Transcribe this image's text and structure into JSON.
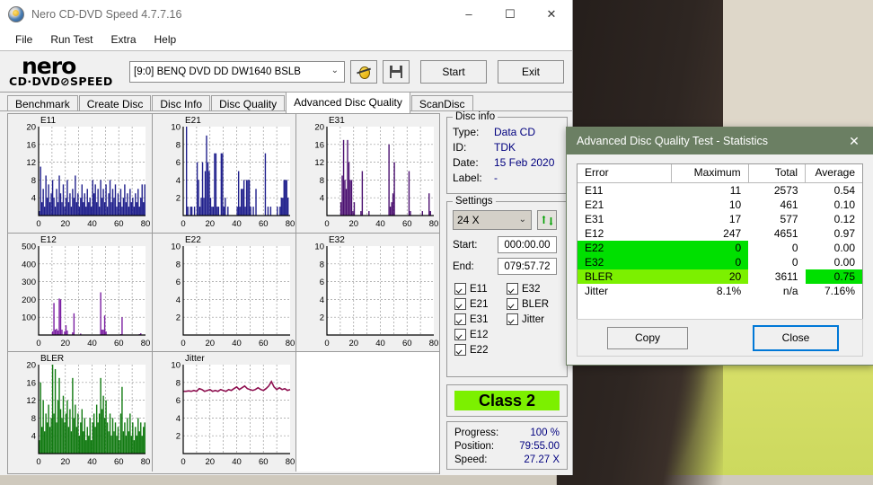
{
  "window": {
    "title": "Nero CD-DVD Speed 4.7.7.16",
    "app_icon": "nero-disc-icon",
    "minimize": "–",
    "maximize": "☐",
    "close": "✕"
  },
  "menu": {
    "items": [
      "File",
      "Run Test",
      "Extra",
      "Help"
    ]
  },
  "logo": {
    "line1": "nero",
    "line2": "CD·DVD⊘SPEED"
  },
  "toolbar": {
    "drive": "[9:0]   BENQ DVD DD DW1640 BSLB",
    "dropdown_caret": "⌄",
    "bug_icon": "bug-icon",
    "save_icon": "floppy-save-icon",
    "start_label": "Start",
    "exit_label": "Exit"
  },
  "tabs": {
    "items": [
      "Benchmark",
      "Create Disc",
      "Disc Info",
      "Disc Quality",
      "Advanced Disc Quality",
      "ScanDisc"
    ],
    "active": "Advanced Disc Quality"
  },
  "disc_info": {
    "legend": "Disc info",
    "rows": [
      {
        "key": "Type:",
        "value": "Data CD"
      },
      {
        "key": "ID:",
        "value": "TDK"
      },
      {
        "key": "Date:",
        "value": "15 Feb 2020"
      },
      {
        "key": "Label:",
        "value": "-"
      }
    ]
  },
  "settings": {
    "legend": "Settings",
    "speed": "24 X",
    "speed_caret": "⌄",
    "refresh_icon": "refresh-icon",
    "start_label": "Start:",
    "start_value": "000:00.00",
    "end_label": "End:",
    "end_value": "079:57.72",
    "checkboxes_left": [
      "E11",
      "E21",
      "E31",
      "E12",
      "E22"
    ],
    "checkboxes_right": [
      "E32",
      "BLER",
      "Jitter"
    ]
  },
  "class_box": {
    "label": "Class 2",
    "color": "#7cf000"
  },
  "progress": {
    "rows": [
      {
        "key": "Progress:",
        "value": "100 %"
      },
      {
        "key": "Position:",
        "value": "79:55.00"
      },
      {
        "key": "Speed:",
        "value": "27.27 X"
      }
    ]
  },
  "dialog": {
    "title": "Advanced Disc Quality Test - Statistics",
    "close_icon": "✕",
    "columns": [
      "Error",
      "Maximum",
      "Total",
      "Average"
    ],
    "rows": [
      {
        "error": "E11",
        "maximum": "11",
        "total": "2573",
        "average": "0.54",
        "hl": "none"
      },
      {
        "error": "E21",
        "maximum": "10",
        "total": "461",
        "average": "0.10",
        "hl": "none"
      },
      {
        "error": "E31",
        "maximum": "17",
        "total": "577",
        "average": "0.12",
        "hl": "none"
      },
      {
        "error": "E12",
        "maximum": "247",
        "total": "4651",
        "average": "0.97",
        "hl": "none"
      },
      {
        "error": "E22",
        "maximum": "0",
        "total": "0",
        "average": "0.00",
        "hl": "green-left"
      },
      {
        "error": "E32",
        "maximum": "0",
        "total": "0",
        "average": "0.00",
        "hl": "green-left"
      },
      {
        "error": "BLER",
        "maximum": "20",
        "total": "3611",
        "average": "0.75",
        "hl": "bler"
      },
      {
        "error": "Jitter",
        "maximum": "8.1%",
        "total": "n/a",
        "average": "7.16%",
        "hl": "none"
      }
    ],
    "copy_label": "Copy",
    "close_label": "Close",
    "highlight_green": "#00e000",
    "highlight_yellowgreen": "#7cf000"
  },
  "chart_data": [
    {
      "type": "bar",
      "title": "E11",
      "xlabel": "",
      "ylabel": "",
      "xlim": [
        0,
        80
      ],
      "ylim": [
        0,
        20
      ],
      "xticks": [
        0,
        20,
        40,
        60,
        80
      ],
      "yticks": [
        4,
        8,
        12,
        16,
        20
      ],
      "grid": true,
      "color": "#20208c",
      "x": [
        0,
        1,
        2,
        3,
        4,
        5,
        6,
        7,
        8,
        9,
        10,
        11,
        12,
        13,
        14,
        15,
        16,
        17,
        18,
        19,
        20,
        21,
        22,
        23,
        24,
        25,
        26,
        27,
        28,
        29,
        30,
        31,
        32,
        33,
        34,
        35,
        36,
        37,
        38,
        39,
        40,
        41,
        42,
        43,
        44,
        45,
        46,
        47,
        48,
        49,
        50,
        51,
        52,
        53,
        54,
        55,
        56,
        57,
        58,
        59,
        60,
        61,
        62,
        63,
        64,
        65,
        66,
        67,
        68,
        69,
        70,
        71,
        72,
        73,
        74,
        75,
        76,
        77,
        78,
        79
      ],
      "values": [
        1,
        11,
        3,
        6,
        2,
        9,
        4,
        7,
        3,
        5,
        8,
        4,
        2,
        6,
        3,
        9,
        5,
        3,
        7,
        2,
        4,
        8,
        3,
        5,
        2,
        6,
        4,
        9,
        3,
        5,
        2,
        4,
        7,
        3,
        5,
        2,
        6,
        3,
        4,
        2,
        8,
        5,
        7,
        3,
        6,
        2,
        8,
        4,
        6,
        3,
        7,
        2,
        5,
        8,
        3,
        6,
        4,
        7,
        2,
        5,
        3,
        6,
        2,
        4,
        7,
        3,
        5,
        2,
        6,
        3,
        4,
        2,
        5,
        3,
        6,
        2,
        4,
        7,
        3,
        7
      ]
    },
    {
      "type": "bar",
      "title": "E21",
      "xlabel": "",
      "ylabel": "",
      "xlim": [
        0,
        80
      ],
      "ylim": [
        0,
        10
      ],
      "xticks": [
        0,
        20,
        40,
        60,
        80
      ],
      "yticks": [
        2,
        4,
        6,
        8,
        10
      ],
      "grid": true,
      "color": "#20208c",
      "x": [
        2,
        3,
        5,
        6,
        8,
        10,
        11,
        12,
        13,
        14,
        15,
        16,
        17,
        18,
        19,
        20,
        21,
        22,
        23,
        24,
        25,
        26,
        28,
        29,
        30,
        31,
        33,
        40,
        41,
        42,
        43,
        44,
        45,
        46,
        47,
        48,
        49,
        50,
        52,
        54,
        61,
        63,
        65,
        70,
        72,
        73,
        74,
        75,
        76,
        77,
        78
      ],
      "values": [
        10,
        1,
        1,
        1,
        1,
        6,
        4,
        1,
        2,
        6,
        2,
        5,
        9,
        6,
        5,
        2,
        1,
        1,
        7,
        7,
        1,
        1,
        7,
        7,
        1,
        2,
        1,
        1,
        5,
        1,
        3,
        3,
        4,
        1,
        4,
        4,
        4,
        1,
        1,
        3,
        7,
        1,
        1,
        1,
        1,
        2,
        2,
        4,
        4,
        4,
        2
      ]
    },
    {
      "type": "bar",
      "title": "E31",
      "xlabel": "",
      "ylabel": "",
      "xlim": [
        0,
        80
      ],
      "ylim": [
        0,
        20
      ],
      "xticks": [
        0,
        20,
        40,
        60,
        80
      ],
      "yticks": [
        4,
        8,
        12,
        16,
        20
      ],
      "grid": true,
      "color": "#4b1070",
      "x": [
        10,
        11,
        12,
        13,
        14,
        15,
        16,
        17,
        18,
        19,
        20,
        25,
        26,
        31,
        46,
        47,
        48,
        49,
        50,
        61,
        62,
        71,
        76,
        77
      ],
      "values": [
        3,
        9,
        17,
        8,
        6,
        17,
        12,
        8,
        8,
        1,
        3,
        1,
        10,
        1,
        16,
        2,
        3,
        5,
        12,
        10,
        1,
        1,
        5,
        1
      ]
    },
    {
      "type": "bar",
      "title": "E12",
      "xlabel": "",
      "ylabel": "",
      "xlim": [
        0,
        80
      ],
      "ylim": [
        0,
        500
      ],
      "xticks": [
        0,
        20,
        40,
        60,
        80
      ],
      "yticks": [
        100,
        200,
        300,
        400,
        500
      ],
      "grid": true,
      "color": "#7b1fa2",
      "x": [
        10,
        11,
        12,
        13,
        14,
        15,
        16,
        17,
        19,
        20,
        21,
        25,
        26,
        31,
        46,
        47,
        48,
        49,
        50,
        61,
        62,
        75,
        76
      ],
      "values": [
        20,
        180,
        30,
        35,
        25,
        205,
        200,
        30,
        20,
        55,
        25,
        15,
        122,
        8,
        240,
        30,
        30,
        110,
        20,
        5,
        100,
        5,
        10
      ]
    },
    {
      "type": "bar",
      "title": "E22",
      "xlabel": "",
      "ylabel": "",
      "xlim": [
        0,
        80
      ],
      "ylim": [
        0,
        10
      ],
      "xticks": [
        0,
        20,
        40,
        60,
        80
      ],
      "yticks": [
        2,
        4,
        6,
        8,
        10
      ],
      "grid": true,
      "color": "#20208c",
      "x": [],
      "values": []
    },
    {
      "type": "bar",
      "title": "E32",
      "xlabel": "",
      "ylabel": "",
      "xlim": [
        0,
        80
      ],
      "ylim": [
        0,
        10
      ],
      "xticks": [
        0,
        20,
        40,
        60,
        80
      ],
      "yticks": [
        2,
        4,
        6,
        8,
        10
      ],
      "grid": true,
      "color": "#20208c",
      "x": [],
      "values": []
    },
    {
      "type": "bar",
      "title": "BLER",
      "xlabel": "",
      "ylabel": "",
      "xlim": [
        0,
        80
      ],
      "ylim": [
        0,
        20
      ],
      "xticks": [
        0,
        20,
        40,
        60,
        80
      ],
      "yticks": [
        4,
        8,
        12,
        16,
        20
      ],
      "grid": true,
      "color": "#117a11",
      "x": [
        0,
        1,
        2,
        3,
        4,
        5,
        6,
        7,
        8,
        9,
        10,
        11,
        12,
        13,
        14,
        15,
        16,
        17,
        18,
        19,
        20,
        21,
        22,
        23,
        24,
        25,
        26,
        27,
        28,
        29,
        30,
        31,
        32,
        33,
        34,
        35,
        36,
        37,
        38,
        39,
        40,
        41,
        42,
        43,
        44,
        45,
        46,
        47,
        48,
        49,
        50,
        51,
        52,
        53,
        54,
        55,
        56,
        57,
        58,
        59,
        60,
        61,
        62,
        63,
        64,
        65,
        66,
        67,
        68,
        69,
        70,
        71,
        72,
        73,
        74,
        75,
        76,
        77,
        78,
        79
      ],
      "values": [
        3,
        16,
        6,
        12,
        5,
        9,
        7,
        11,
        6,
        8,
        20,
        9,
        19,
        7,
        12,
        17,
        10,
        8,
        13,
        7,
        9,
        12,
        6,
        10,
        5,
        17,
        8,
        11,
        6,
        9,
        4,
        7,
        10,
        5,
        8,
        3,
        6,
        4,
        8,
        3,
        7,
        9,
        6,
        11,
        7,
        9,
        17,
        10,
        13,
        8,
        12,
        7,
        5,
        9,
        4,
        8,
        5,
        7,
        4,
        6,
        3,
        9,
        15,
        5,
        7,
        4,
        8,
        5,
        9,
        4,
        7,
        3,
        6,
        4,
        8,
        5,
        7,
        4,
        6,
        7
      ]
    },
    {
      "type": "line",
      "title": "Jitter",
      "xlabel": "",
      "ylabel": "",
      "xlim": [
        0,
        80
      ],
      "ylim": [
        0,
        10
      ],
      "xticks": [
        0,
        20,
        40,
        60,
        80
      ],
      "yticks": [
        2,
        4,
        6,
        8,
        10
      ],
      "grid": true,
      "color": "#8e1050",
      "x": [
        0,
        2,
        4,
        6,
        8,
        10,
        12,
        14,
        16,
        18,
        20,
        22,
        24,
        26,
        28,
        30,
        32,
        34,
        36,
        38,
        40,
        42,
        44,
        46,
        48,
        50,
        52,
        54,
        56,
        58,
        60,
        62,
        64,
        66,
        68,
        70,
        72,
        74,
        76,
        78,
        80
      ],
      "values": [
        7.0,
        7.0,
        7.05,
        7.0,
        7.1,
        7.0,
        7.3,
        7.2,
        7.0,
        7.1,
        7.2,
        7.0,
        7.1,
        7.0,
        7.2,
        7.1,
        7.0,
        7.2,
        7.1,
        7.3,
        7.5,
        7.2,
        7.4,
        7.6,
        7.3,
        7.2,
        7.1,
        7.2,
        7.4,
        7.2,
        7.1,
        7.3,
        7.6,
        8.1,
        7.5,
        7.2,
        7.4,
        7.2,
        7.3,
        7.1,
        7.2
      ]
    }
  ]
}
